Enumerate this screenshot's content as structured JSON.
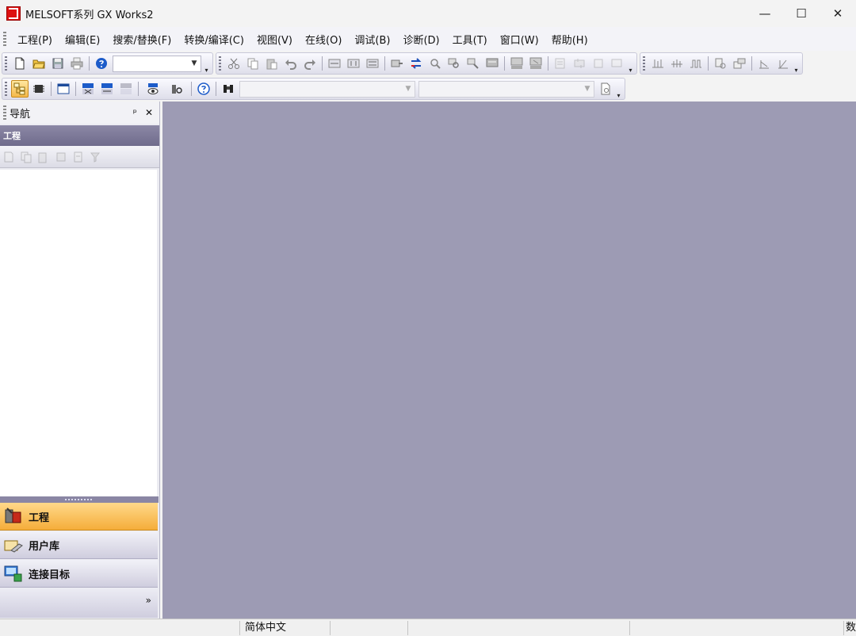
{
  "window": {
    "title": "MELSOFT系列 GX Works2",
    "minimize_glyph": "—",
    "maximize_glyph": "☐",
    "close_glyph": "✕"
  },
  "menu": {
    "items": [
      "工程(P)",
      "编辑(E)",
      "搜索/替换(F)",
      "转换/编译(C)",
      "视图(V)",
      "在线(O)",
      "调试(B)",
      "诊断(D)",
      "工具(T)",
      "窗口(W)",
      "帮助(H)"
    ]
  },
  "toolbar": {
    "more_glyph": "▾",
    "combo_arrow_glyph": "▼"
  },
  "nav": {
    "title": "导航",
    "pin_glyph": "ᵖ",
    "close_glyph": "✕",
    "section_label": "工程",
    "tabs": [
      "工程",
      "用户库",
      "连接目标"
    ],
    "more_glyph": "»"
  },
  "status": {
    "language": "简体中文",
    "right_edge": "数"
  },
  "colors": {
    "workspace": "#9d9bb4",
    "active_tab": "#f5ad3a",
    "section_header": "#6f6b8c"
  }
}
